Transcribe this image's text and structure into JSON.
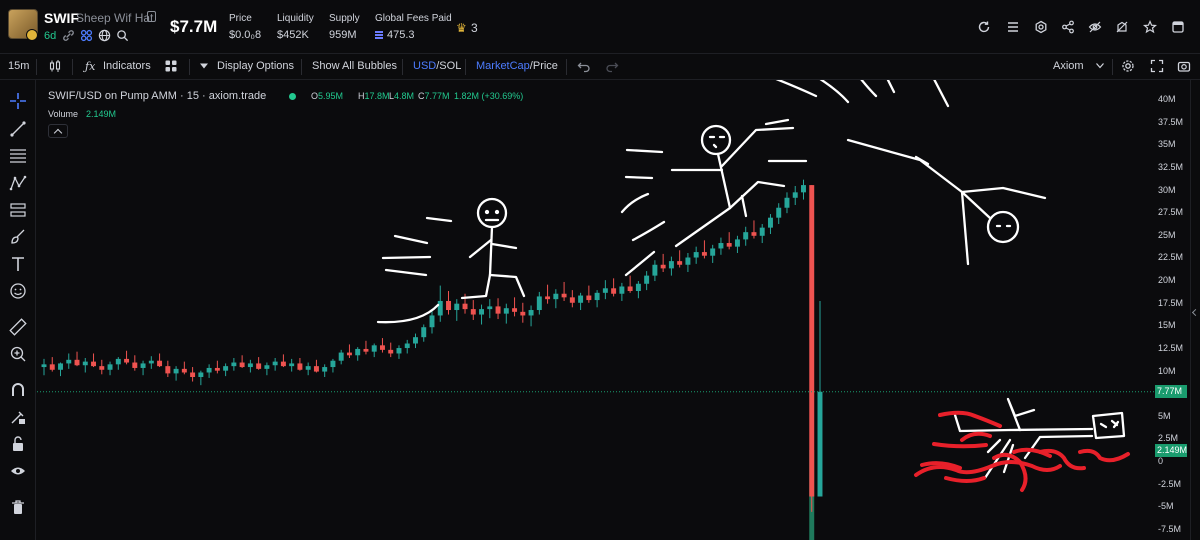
{
  "header": {
    "ticker": "SWIF",
    "token_name": "Sheep Wif Hat",
    "age": "6d",
    "market_cap": "$7.7M",
    "stats": [
      {
        "label": "Price",
        "value": "$0.0₀8"
      },
      {
        "label": "Liquidity",
        "value": "$452K"
      },
      {
        "label": "Supply",
        "value": "959M"
      },
      {
        "label": "Global Fees Paid",
        "value": "475.3"
      }
    ],
    "holders_count": "3",
    "right_icons": [
      "refresh-icon",
      "list-icon",
      "settings-icon",
      "share-icon",
      "eye-off-icon",
      "hide-icon",
      "star-icon",
      "window-icon"
    ]
  },
  "toolbar": {
    "interval": "15m",
    "indicators_label": "Indicators",
    "display_options_label": "Display Options",
    "show_bubbles_label": "Show All Bubbles",
    "currency_active": "USD",
    "currency_sep": "/",
    "currency_other": "SOL",
    "metric_active": "MarketCap",
    "metric_sep": "/",
    "metric_other": "Price",
    "source": "Axiom"
  },
  "legend": {
    "title": "SWIF/USD on Pump AMM · 15 · axiom.trade",
    "ohlc": [
      {
        "label": "O",
        "value": "5.95M"
      },
      {
        "label": "H",
        "value": "17.8M"
      },
      {
        "label": "L",
        "value": "4.8M"
      },
      {
        "label": "C",
        "value": "7.77M"
      },
      {
        "label": "",
        "value": "1.82M (+30.69%)"
      }
    ],
    "volume_label": "Volume",
    "volume_value": "2.149M"
  },
  "axis": {
    "current_price_tag": "7.77M",
    "volume_tag": "2.149M"
  },
  "colors": {
    "up": "#26a69a",
    "down": "#ef5350",
    "accent": "#4d7cff",
    "green_text": "#22c98f",
    "doodle_white": "#ffffff",
    "doodle_red": "#e8202a"
  },
  "chart_data": {
    "type": "candlestick",
    "title": "SWIF/USD on Pump AMM · 15 · axiom.trade",
    "y_axis_ticks": [
      "40M",
      "37.5M",
      "35M",
      "32.5M",
      "30M",
      "27.5M",
      "25M",
      "22.5M",
      "20M",
      "17.5M",
      "15M",
      "12.5M",
      "10M",
      "7.5M",
      "5M",
      "2.5M",
      "0",
      "-2.5M",
      "-5M",
      "-7.5M"
    ],
    "ylim": [
      -8000000,
      41000000
    ],
    "current_value": 7770000,
    "candles": [
      [
        10.5,
        11.4,
        9.6,
        10.8
      ],
      [
        10.8,
        11.6,
        10.0,
        10.2
      ],
      [
        10.2,
        11.0,
        9.5,
        10.9
      ],
      [
        10.9,
        12.0,
        10.3,
        11.3
      ],
      [
        11.3,
        12.2,
        10.6,
        10.7
      ],
      [
        10.7,
        11.5,
        9.9,
        11.1
      ],
      [
        11.1,
        12.0,
        10.5,
        10.6
      ],
      [
        10.6,
        11.3,
        9.7,
        10.2
      ],
      [
        10.2,
        11.1,
        9.6,
        10.8
      ],
      [
        10.8,
        11.6,
        10.2,
        11.4
      ],
      [
        11.4,
        12.3,
        10.8,
        11.0
      ],
      [
        11.0,
        11.8,
        10.1,
        10.4
      ],
      [
        10.4,
        11.2,
        9.6,
        10.9
      ],
      [
        10.9,
        11.7,
        10.3,
        11.2
      ],
      [
        11.2,
        12.0,
        10.5,
        10.6
      ],
      [
        10.6,
        11.2,
        9.4,
        9.8
      ],
      [
        9.8,
        10.6,
        9.0,
        10.3
      ],
      [
        10.3,
        11.1,
        9.7,
        9.9
      ],
      [
        9.9,
        10.5,
        8.9,
        9.4
      ],
      [
        9.4,
        10.1,
        8.5,
        9.9
      ],
      [
        9.9,
        10.8,
        9.3,
        10.4
      ],
      [
        10.4,
        11.2,
        9.8,
        10.1
      ],
      [
        10.1,
        10.9,
        9.5,
        10.6
      ],
      [
        10.6,
        11.5,
        10.1,
        11.0
      ],
      [
        11.0,
        11.8,
        10.4,
        10.5
      ],
      [
        10.5,
        11.3,
        9.9,
        10.9
      ],
      [
        10.9,
        11.6,
        10.2,
        10.3
      ],
      [
        10.3,
        11.0,
        9.6,
        10.7
      ],
      [
        10.7,
        11.5,
        10.1,
        11.1
      ],
      [
        11.1,
        11.9,
        10.5,
        10.6
      ],
      [
        10.6,
        11.4,
        10.0,
        10.9
      ],
      [
        10.9,
        11.5,
        10.1,
        10.2
      ],
      [
        10.2,
        11.0,
        9.6,
        10.6
      ],
      [
        10.6,
        11.3,
        9.9,
        10.0
      ],
      [
        10.0,
        10.8,
        9.4,
        10.5
      ],
      [
        10.5,
        11.4,
        9.9,
        11.2
      ],
      [
        11.2,
        12.4,
        10.8,
        12.1
      ],
      [
        12.1,
        13.0,
        11.5,
        11.8
      ],
      [
        11.8,
        12.7,
        11.2,
        12.5
      ],
      [
        12.5,
        13.4,
        11.9,
        12.2
      ],
      [
        12.2,
        13.1,
        11.6,
        12.9
      ],
      [
        12.9,
        13.7,
        12.1,
        12.4
      ],
      [
        12.4,
        13.2,
        11.6,
        12.0
      ],
      [
        12.0,
        12.9,
        11.4,
        12.6
      ],
      [
        12.6,
        13.5,
        12.0,
        13.1
      ],
      [
        13.1,
        14.2,
        12.6,
        13.8
      ],
      [
        13.8,
        15.2,
        13.3,
        14.9
      ],
      [
        14.9,
        16.8,
        14.2,
        16.2
      ],
      [
        16.2,
        19.5,
        15.5,
        17.8
      ],
      [
        17.8,
        18.9,
        16.3,
        16.8
      ],
      [
        16.8,
        18.0,
        15.6,
        17.5
      ],
      [
        17.5,
        18.6,
        16.4,
        16.9
      ],
      [
        16.9,
        17.9,
        15.7,
        16.3
      ],
      [
        16.3,
        17.4,
        15.2,
        16.9
      ],
      [
        16.9,
        18.0,
        15.9,
        17.2
      ],
      [
        17.2,
        18.1,
        15.8,
        16.4
      ],
      [
        16.4,
        17.5,
        15.3,
        17.0
      ],
      [
        17.0,
        18.2,
        16.1,
        16.6
      ],
      [
        16.6,
        17.6,
        15.4,
        16.2
      ],
      [
        16.2,
        17.3,
        15.0,
        16.8
      ],
      [
        16.8,
        18.8,
        16.3,
        18.3
      ],
      [
        18.3,
        19.6,
        17.5,
        18.0
      ],
      [
        18.0,
        19.1,
        17.0,
        18.6
      ],
      [
        18.6,
        19.9,
        17.8,
        18.2
      ],
      [
        18.2,
        19.0,
        17.1,
        17.6
      ],
      [
        17.6,
        18.7,
        16.8,
        18.4
      ],
      [
        18.4,
        19.5,
        17.6,
        17.9
      ],
      [
        17.9,
        19.0,
        17.1,
        18.7
      ],
      [
        18.7,
        20.1,
        18.0,
        19.2
      ],
      [
        19.2,
        20.3,
        18.3,
        18.6
      ],
      [
        18.6,
        19.8,
        17.8,
        19.4
      ],
      [
        19.4,
        20.6,
        18.7,
        18.9
      ],
      [
        18.9,
        20.0,
        18.1,
        19.7
      ],
      [
        19.7,
        21.1,
        19.0,
        20.6
      ],
      [
        20.6,
        22.3,
        20.0,
        21.8
      ],
      [
        21.8,
        23.0,
        21.0,
        21.4
      ],
      [
        21.4,
        22.7,
        20.6,
        22.2
      ],
      [
        22.2,
        23.4,
        21.5,
        21.8
      ],
      [
        21.8,
        23.1,
        21.0,
        22.6
      ],
      [
        22.6,
        23.8,
        21.9,
        23.2
      ],
      [
        23.2,
        24.5,
        22.5,
        22.8
      ],
      [
        22.8,
        24.0,
        22.0,
        23.6
      ],
      [
        23.6,
        24.8,
        22.9,
        24.2
      ],
      [
        24.2,
        25.4,
        23.5,
        23.8
      ],
      [
        23.8,
        25.0,
        23.1,
        24.6
      ],
      [
        24.6,
        26.0,
        23.9,
        25.4
      ],
      [
        25.4,
        26.7,
        24.7,
        25.0
      ],
      [
        25.0,
        26.3,
        24.2,
        25.9
      ],
      [
        25.9,
        27.4,
        25.2,
        27.0
      ],
      [
        27.0,
        28.6,
        26.3,
        28.1
      ],
      [
        28.1,
        29.8,
        27.5,
        29.2
      ],
      [
        29.2,
        30.5,
        28.4,
        29.8
      ],
      [
        29.8,
        31.2,
        29.0,
        30.6
      ],
      [
        30.6,
        29.5,
        -5.5,
        -3.8
      ],
      [
        -3.8,
        17.8,
        4.8,
        7.77
      ]
    ],
    "volume": [
      0,
      0,
      0,
      0,
      0,
      0,
      0,
      0,
      0,
      0,
      0,
      0,
      0,
      0,
      0,
      0,
      0,
      0,
      0,
      0,
      0,
      0,
      0,
      0,
      0,
      0,
      0,
      0,
      0,
      0,
      0,
      0,
      0,
      0,
      0,
      0,
      0,
      0,
      0,
      0,
      0,
      0,
      0,
      0,
      0,
      0,
      0,
      0,
      0,
      0,
      0,
      0,
      0,
      0,
      0,
      0,
      0,
      0,
      0,
      0,
      0,
      0,
      0,
      0,
      0,
      0,
      0,
      0,
      0,
      0,
      0,
      0,
      0,
      0,
      0,
      0,
      0,
      0,
      0,
      0,
      0,
      0,
      0,
      0,
      0,
      0,
      0,
      0,
      0,
      0,
      0,
      0,
      0,
      2.149,
      0
    ]
  }
}
